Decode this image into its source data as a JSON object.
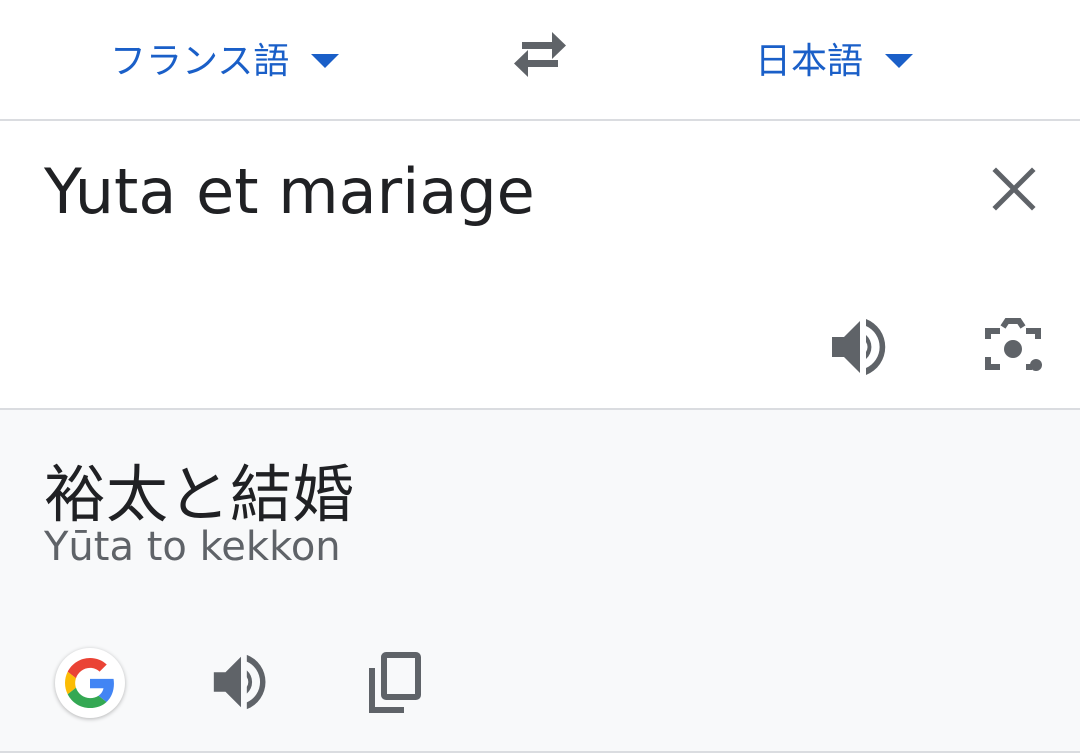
{
  "language_bar": {
    "source_language": "フランス語",
    "target_language": "日本語",
    "swap_icon": "swap-arrows-icon",
    "dropdown_icon": "caret-down-icon",
    "accent_color": "#1a5fc8"
  },
  "input": {
    "text": "Yuta et mariage",
    "clear_icon": "close-icon",
    "speak_icon": "speaker-icon",
    "camera_icon": "camera-lens-icon"
  },
  "output": {
    "translation": "裕太と結婚",
    "romanization": "Yūta to kekkon",
    "google_icon": "google-logo-icon",
    "speak_icon": "speaker-icon",
    "copy_icon": "copy-icon"
  },
  "colors": {
    "text_primary": "#202124",
    "text_secondary": "#5f6368",
    "icon_gray": "#5f6368",
    "output_background": "#f8f9fa",
    "divider": "#dadce0"
  }
}
